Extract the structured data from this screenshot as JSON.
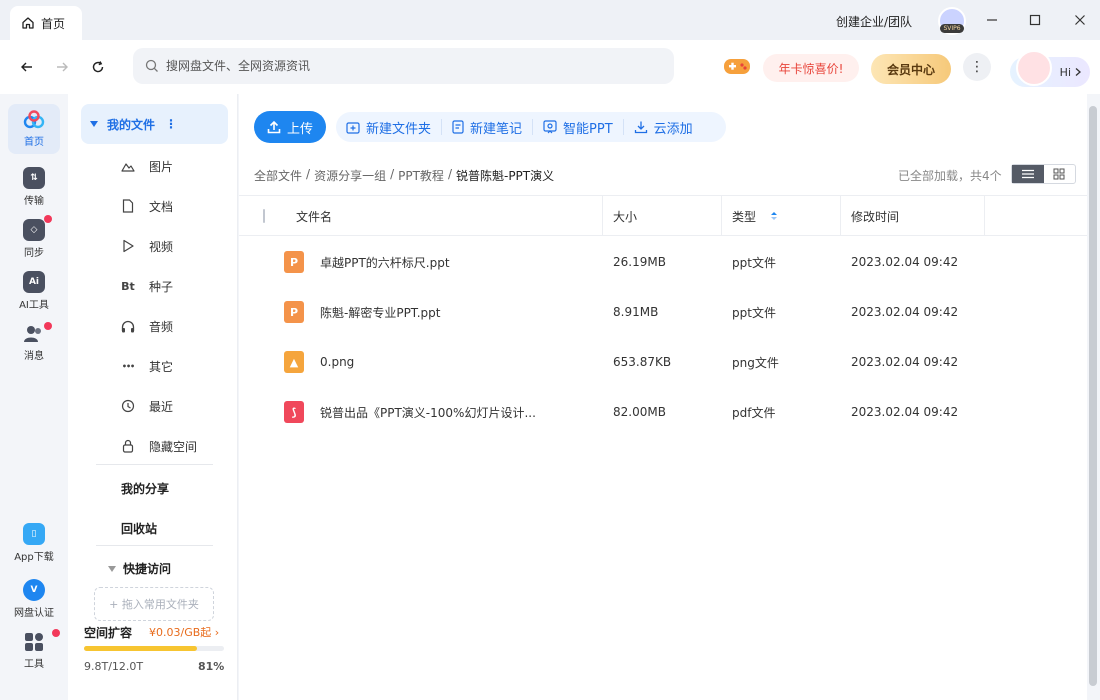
{
  "window": {
    "tab_label": "首页",
    "create_org": "创建企业/团队",
    "svip_badge": "SVIP6"
  },
  "search": {
    "placeholder": "搜网盘文件、全网资源资讯"
  },
  "header": {
    "promo_label": "年卡惊喜价!",
    "vip_center_label": "会员中心",
    "more_label": "⋮",
    "hi_label": "Hi"
  },
  "rail": {
    "items": [
      {
        "label": "首页",
        "icon": "cloud-logo-icon",
        "active": true
      },
      {
        "label": "传输",
        "icon": "transfer-icon"
      },
      {
        "label": "同步",
        "icon": "sync-icon"
      },
      {
        "label": "AI工具",
        "icon": "ai-tools-icon",
        "glyph": "Ai"
      },
      {
        "label": "消息",
        "icon": "message-icon"
      },
      {
        "label": "App下载",
        "icon": "phone-icon"
      },
      {
        "label": "网盘认证",
        "icon": "verify-shield-icon",
        "glyph": "V"
      },
      {
        "label": "工具",
        "icon": "tools-grid-icon"
      }
    ]
  },
  "sidebar": {
    "my_files": "我的文件",
    "items": [
      {
        "label": "图片",
        "icon": "image-icon"
      },
      {
        "label": "文档",
        "icon": "document-icon"
      },
      {
        "label": "视频",
        "icon": "video-icon"
      },
      {
        "label": "种子",
        "icon": "torrent-icon",
        "glyph": "Bt"
      },
      {
        "label": "音频",
        "icon": "headphones-icon"
      },
      {
        "label": "其它",
        "icon": "more-dots-icon",
        "glyph": "•••"
      },
      {
        "label": "最近",
        "icon": "recent-clock-icon"
      },
      {
        "label": "隐藏空间",
        "icon": "lock-icon"
      }
    ],
    "my_share": "我的分享",
    "recycle_bin": "回收站",
    "quick_access": "快捷访问",
    "drop_hint": "+ 拖入常用文件夹",
    "storage": {
      "label": "空间扩容",
      "price": "¥0.03/GB起",
      "used": "9.8T/12.0T",
      "percent_text": "81%",
      "fraction": 0.81
    }
  },
  "toolbar": {
    "upload": "上传",
    "actions": [
      {
        "label": "新建文件夹",
        "icon": "new-folder-icon"
      },
      {
        "label": "新建笔记",
        "icon": "new-note-icon"
      },
      {
        "label": "智能PPT",
        "icon": "smart-ppt-icon"
      },
      {
        "label": "云添加",
        "icon": "cloud-add-icon"
      }
    ]
  },
  "breadcrumb": [
    "全部文件",
    "资源分享一组",
    "PPT教程",
    "锐普陈魁-PPT演义"
  ],
  "status": {
    "loaded": "已全部加载，共4个"
  },
  "table": {
    "columns": [
      "文件名",
      "大小",
      "类型",
      "修改时间"
    ],
    "rows": [
      {
        "name": "卓越PPT的六杆标尺.ppt",
        "size": "26.19MB",
        "type": "ppt文件",
        "modified": "2023.02.04 09:42",
        "icon": "ppt-file-icon",
        "glyph": "P",
        "color": "#f4934a"
      },
      {
        "name": "陈魁-解密专业PPT.ppt",
        "size": "8.91MB",
        "type": "ppt文件",
        "modified": "2023.02.04 09:42",
        "icon": "ppt-file-icon",
        "glyph": "P",
        "color": "#f4934a"
      },
      {
        "name": "0.png",
        "size": "653.87KB",
        "type": "png文件",
        "modified": "2023.02.04 09:42",
        "icon": "image-file-icon",
        "glyph": "▲",
        "color": "#f5a53d"
      },
      {
        "name": "锐普出品《PPT演义-100%幻灯片设计...",
        "size": "82.00MB",
        "type": "pdf文件",
        "modified": "2023.02.04 09:42",
        "icon": "pdf-file-icon",
        "glyph": "⟆",
        "color": "#f0485b"
      }
    ]
  },
  "colors": {
    "accent": "#1e86f0",
    "badge_red": "#f2385a",
    "storage_bar": "#f7c531"
  }
}
